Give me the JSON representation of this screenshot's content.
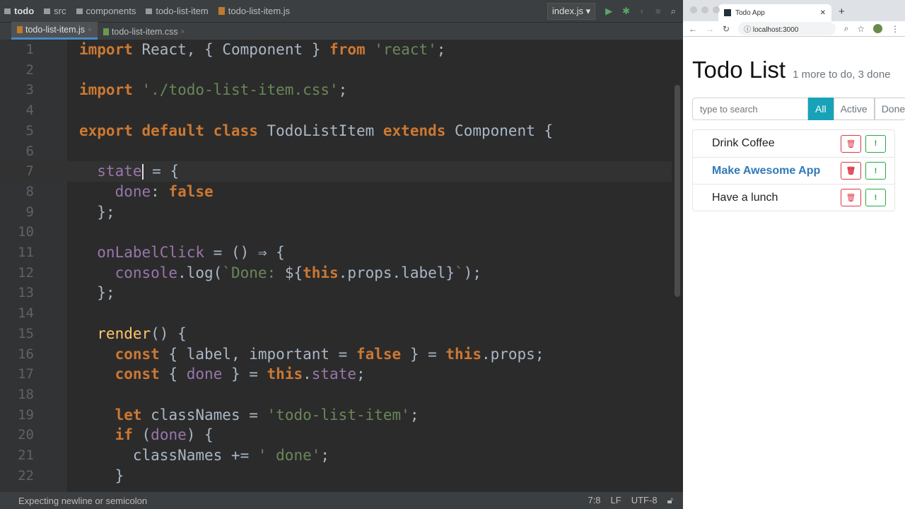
{
  "ide": {
    "breadcrumbs": [
      "todo",
      "src",
      "components",
      "todo-list-item",
      "todo-list-item.js"
    ],
    "run_config": "index.js",
    "tabs": [
      "todo-list-item.js",
      "todo-list-item.css"
    ],
    "status_message": "Expecting newline or semicolon",
    "cursor_pos": "7:8",
    "line_sep": "LF",
    "encoding": "UTF-8",
    "lines": [
      [
        [
          "kw",
          "import "
        ],
        [
          "",
          "React, { "
        ],
        [
          "",
          "Component"
        ],
        [
          "",
          " } "
        ],
        [
          "kw",
          "from "
        ],
        [
          "str",
          "'react'"
        ],
        [
          "",
          ";"
        ]
      ],
      [],
      [
        [
          "kw",
          "import "
        ],
        [
          "str",
          "'./todo-list-item.css'"
        ],
        [
          "",
          ";"
        ]
      ],
      [],
      [
        [
          "kw",
          "export default class "
        ],
        [
          "",
          "TodoListItem "
        ],
        [
          "kw",
          "extends "
        ],
        [
          "",
          "Component {"
        ]
      ],
      [],
      [
        [
          "prop",
          "  state"
        ],
        [
          "caret",
          ""
        ],
        [
          "",
          " = {"
        ]
      ],
      [
        [
          "prop",
          "    done"
        ],
        [
          "",
          ": "
        ],
        [
          "kw",
          "false"
        ]
      ],
      [
        [
          "",
          "  };"
        ]
      ],
      [],
      [
        [
          "prop",
          "  onLabelClick"
        ],
        [
          "",
          " = () ⇒ {"
        ]
      ],
      [
        [
          "prop",
          "    console"
        ],
        [
          "",
          ".log("
        ],
        [
          "tpl",
          "`Done: "
        ],
        [
          "",
          "${"
        ],
        [
          "kw",
          "this"
        ],
        [
          "",
          ".props.label}"
        ],
        [
          "tpl",
          "`"
        ],
        [
          "",
          ");"
        ]
      ],
      [
        [
          "",
          "  };"
        ]
      ],
      [],
      [
        [
          "fn",
          "  render"
        ],
        [
          "",
          "() {"
        ]
      ],
      [
        [
          "kw",
          "    const "
        ],
        [
          "",
          "{ label, important = "
        ],
        [
          "kw",
          "false"
        ],
        [
          "",
          " } = "
        ],
        [
          "kw",
          "this"
        ],
        [
          "",
          ".props;"
        ]
      ],
      [
        [
          "kw",
          "    const "
        ],
        [
          "",
          "{ "
        ],
        [
          "prop",
          "done"
        ],
        [
          "",
          " } = "
        ],
        [
          "kw",
          "this"
        ],
        [
          "",
          "."
        ],
        [
          "prop",
          "state"
        ],
        [
          "",
          ";"
        ]
      ],
      [],
      [
        [
          "kw",
          "    let "
        ],
        [
          "",
          "classNames = "
        ],
        [
          "str",
          "'todo-list-item'"
        ],
        [
          "",
          ";"
        ]
      ],
      [
        [
          "kw",
          "    if "
        ],
        [
          "",
          "("
        ],
        [
          "prop",
          "done"
        ],
        [
          "",
          ") {"
        ]
      ],
      [
        [
          "",
          "      classNames += "
        ],
        [
          "str",
          "' done'"
        ],
        [
          "",
          ";"
        ]
      ],
      [
        [
          "",
          "    }"
        ]
      ]
    ]
  },
  "browser": {
    "tab_title": "Todo App",
    "url": "localhost:3000",
    "title": "Todo List",
    "subtitle": "1 more to do, 3 done",
    "search_placeholder": "type to search",
    "filters": [
      "All",
      "Active",
      "Done"
    ],
    "items": [
      {
        "label": "Drink Coffee",
        "important": false
      },
      {
        "label": "Make Awesome App",
        "important": true
      },
      {
        "label": "Have a lunch",
        "important": false
      }
    ]
  }
}
